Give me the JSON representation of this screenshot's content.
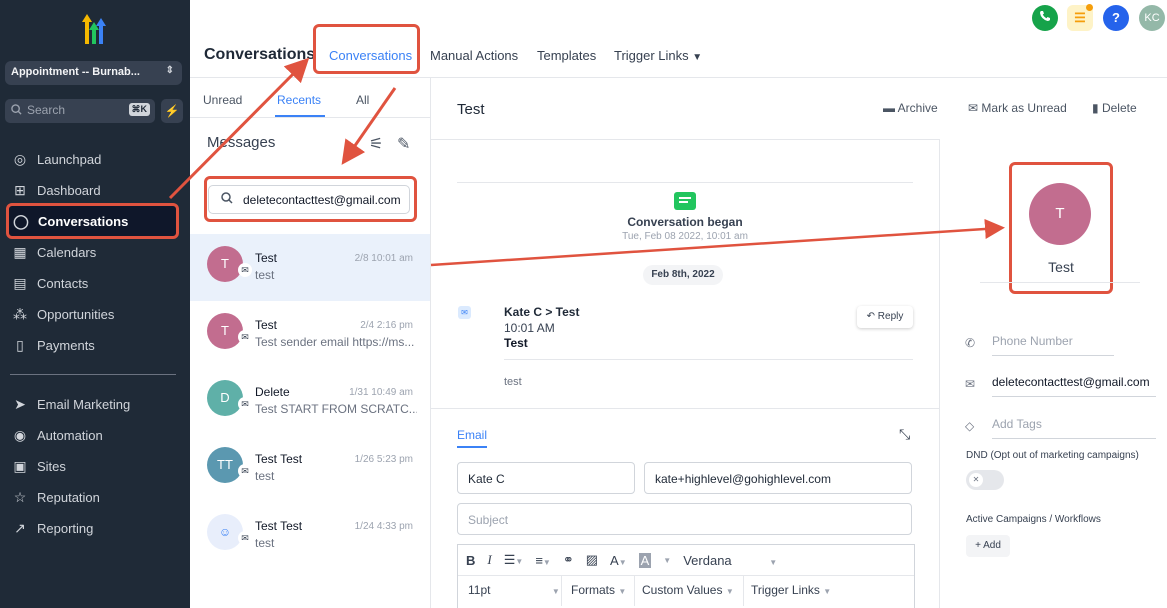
{
  "sidebar": {
    "location": "Appointment -- Burnab...",
    "search_placeholder": "Search",
    "search_shortcut": "⌘K",
    "items": [
      {
        "label": "Launchpad",
        "icon": "rocket-icon"
      },
      {
        "label": "Dashboard",
        "icon": "grid-icon"
      },
      {
        "label": "Conversations",
        "icon": "chat-icon"
      },
      {
        "label": "Calendars",
        "icon": "calendar-icon"
      },
      {
        "label": "Contacts",
        "icon": "contacts-icon"
      },
      {
        "label": "Opportunities",
        "icon": "network-icon"
      },
      {
        "label": "Payments",
        "icon": "receipt-icon"
      }
    ],
    "items2": [
      {
        "label": "Email Marketing",
        "icon": "send-icon"
      },
      {
        "label": "Automation",
        "icon": "automation-icon"
      },
      {
        "label": "Sites",
        "icon": "sites-icon"
      },
      {
        "label": "Reputation",
        "icon": "star-icon"
      },
      {
        "label": "Reporting",
        "icon": "trend-icon"
      }
    ]
  },
  "header": {
    "title": "Conversations",
    "tabs": [
      "Conversations",
      "Manual Actions",
      "Templates",
      "Trigger Links"
    ],
    "avatar_initials": "KC",
    "help": "?"
  },
  "list": {
    "tabs": [
      "Unread",
      "Recents",
      "All"
    ],
    "heading": "Messages",
    "search_value": "deletecontacttest@gmail.com",
    "conversations": [
      {
        "initials": "T",
        "name": "Test",
        "date": "2/8 10:01 am",
        "preview": "test",
        "color": "#c26d8f"
      },
      {
        "initials": "T",
        "name": "Test",
        "date": "2/4 2:16 pm",
        "preview": "Test sender email https://ms...",
        "color": "#c26d8f"
      },
      {
        "initials": "D",
        "name": "Delete",
        "date": "1/31 10:49 am",
        "preview": "Test START FROM SCRATC...",
        "color": "#5fb0a8"
      },
      {
        "initials": "TT",
        "name": "Test Test",
        "date": "1/26 5:23 pm",
        "preview": "test",
        "color": "#5b98b0"
      },
      {
        "initials": "",
        "name": "Test Test",
        "date": "1/24 4:33 pm",
        "preview": "test",
        "color": "#e8eefb"
      }
    ]
  },
  "conversation": {
    "title": "Test",
    "actions": [
      "Archive",
      "Mark as Unread",
      "Delete"
    ],
    "began_title": "Conversation began",
    "began_date": "Tue, Feb 08 2022, 10:01 am",
    "date_pill": "Feb 8th, 2022",
    "message": {
      "from": "Kate C > Test",
      "time": "10:01 AM",
      "subject": "Test",
      "body": "test",
      "reply_label": "Reply"
    },
    "composer": {
      "tab": "Email",
      "from_name": "Kate C",
      "from_email": "kate+highlevel@gohighlevel.com",
      "subject_placeholder": "Subject",
      "font_name": "Verdana",
      "font_size": "11pt",
      "formats": "Formats",
      "custom_values": "Custom Values",
      "trigger_links": "Trigger Links"
    }
  },
  "contact": {
    "initial": "T",
    "name": "Test",
    "phone_placeholder": "Phone Number",
    "email": "deletecontacttest@gmail.com",
    "tags_placeholder": "Add Tags",
    "dnd_label": "DND (Opt out of marketing campaigns)",
    "campaigns_label": "Active Campaigns / Workflows",
    "add_label": "+ Add"
  },
  "colors": {
    "sidebar_bg": "#1f2a37",
    "accent": "#3b82f6",
    "annotation": "#e0533f"
  }
}
